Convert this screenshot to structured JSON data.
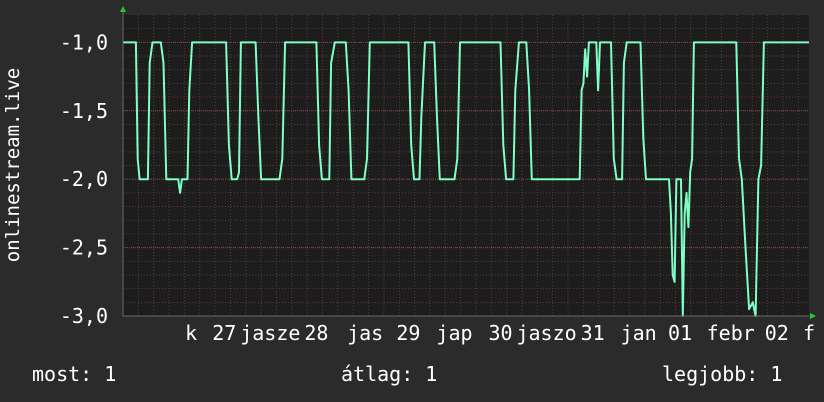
{
  "chart_data": {
    "type": "line",
    "ylabel": "onlinestream.live",
    "ylim": [
      -3.0,
      -0.8
    ],
    "yticks": [
      -3.0,
      -2.5,
      -2.0,
      -1.5,
      -1.0
    ],
    "ytick_labels": [
      "-3,0",
      "-2,5",
      "-2,0",
      "-1,5",
      "-1,0"
    ],
    "x_labels": [
      {
        "x": 0.74,
        "label": "k"
      },
      {
        "x": 1.1,
        "label": "27"
      },
      {
        "x": 1.6,
        "label": "jasze"
      },
      {
        "x": 2.1,
        "label": "28"
      },
      {
        "x": 2.63,
        "label": "jas"
      },
      {
        "x": 3.1,
        "label": "29"
      },
      {
        "x": 3.6,
        "label": "jap"
      },
      {
        "x": 4.1,
        "label": "30"
      },
      {
        "x": 4.6,
        "label": "jaszo"
      },
      {
        "x": 5.1,
        "label": "31"
      },
      {
        "x": 5.6,
        "label": "jan"
      },
      {
        "x": 6.05,
        "label": "01"
      },
      {
        "x": 6.6,
        "label": "febr"
      },
      {
        "x": 7.1,
        "label": "02"
      },
      {
        "x": 7.45,
        "label": "f"
      }
    ],
    "xlim": [
      0,
      7.45
    ],
    "grid": true,
    "series": [
      {
        "color": "#7fffc4",
        "points": [
          [
            0.0,
            -1.0
          ],
          [
            0.14,
            -1.0
          ],
          [
            0.16,
            -1.85
          ],
          [
            0.18,
            -2.0
          ],
          [
            0.27,
            -2.0
          ],
          [
            0.29,
            -1.15
          ],
          [
            0.32,
            -1.0
          ],
          [
            0.41,
            -1.0
          ],
          [
            0.44,
            -1.15
          ],
          [
            0.47,
            -2.0
          ],
          [
            0.6,
            -2.0
          ],
          [
            0.62,
            -2.1
          ],
          [
            0.64,
            -2.0
          ],
          [
            0.7,
            -2.0
          ],
          [
            0.72,
            -1.35
          ],
          [
            0.75,
            -1.0
          ],
          [
            1.12,
            -1.0
          ],
          [
            1.15,
            -1.75
          ],
          [
            1.18,
            -2.0
          ],
          [
            1.24,
            -2.0
          ],
          [
            1.26,
            -1.95
          ],
          [
            1.28,
            -1.0
          ],
          [
            1.44,
            -1.0
          ],
          [
            1.47,
            -1.55
          ],
          [
            1.5,
            -2.0
          ],
          [
            1.7,
            -2.0
          ],
          [
            1.73,
            -1.85
          ],
          [
            1.76,
            -1.0
          ],
          [
            2.1,
            -1.0
          ],
          [
            2.13,
            -1.75
          ],
          [
            2.16,
            -2.0
          ],
          [
            2.24,
            -2.0
          ],
          [
            2.26,
            -1.15
          ],
          [
            2.3,
            -1.0
          ],
          [
            2.42,
            -1.0
          ],
          [
            2.45,
            -1.35
          ],
          [
            2.48,
            -2.0
          ],
          [
            2.62,
            -2.0
          ],
          [
            2.65,
            -1.85
          ],
          [
            2.68,
            -1.0
          ],
          [
            3.1,
            -1.0
          ],
          [
            3.13,
            -1.75
          ],
          [
            3.16,
            -2.0
          ],
          [
            3.22,
            -2.0
          ],
          [
            3.24,
            -1.55
          ],
          [
            3.28,
            -1.0
          ],
          [
            3.38,
            -1.0
          ],
          [
            3.41,
            -1.55
          ],
          [
            3.44,
            -2.0
          ],
          [
            3.6,
            -2.0
          ],
          [
            3.63,
            -1.85
          ],
          [
            3.66,
            -1.0
          ],
          [
            4.1,
            -1.0
          ],
          [
            4.13,
            -1.75
          ],
          [
            4.16,
            -2.0
          ],
          [
            4.24,
            -2.0
          ],
          [
            4.26,
            -1.35
          ],
          [
            4.3,
            -1.0
          ],
          [
            4.38,
            -1.0
          ],
          [
            4.41,
            -1.35
          ],
          [
            4.44,
            -2.0
          ],
          [
            4.96,
            -2.0
          ],
          [
            4.98,
            -1.35
          ],
          [
            5.0,
            -1.3
          ],
          [
            5.02,
            -1.05
          ],
          [
            5.04,
            -1.25
          ],
          [
            5.06,
            -1.0
          ],
          [
            5.14,
            -1.0
          ],
          [
            5.16,
            -1.35
          ],
          [
            5.18,
            -1.0
          ],
          [
            5.3,
            -1.0
          ],
          [
            5.33,
            -1.85
          ],
          [
            5.36,
            -2.0
          ],
          [
            5.42,
            -2.0
          ],
          [
            5.44,
            -1.15
          ],
          [
            5.47,
            -1.0
          ],
          [
            5.62,
            -1.0
          ],
          [
            5.65,
            -1.7
          ],
          [
            5.68,
            -2.0
          ],
          [
            5.9,
            -2.0
          ],
          [
            5.93,
            -2.0
          ],
          [
            5.95,
            -2.25
          ],
          [
            5.97,
            -2.7
          ],
          [
            5.99,
            -2.75
          ],
          [
            6.01,
            -2.0
          ],
          [
            6.06,
            -2.0
          ],
          [
            6.08,
            -3.0
          ],
          [
            6.1,
            -2.25
          ],
          [
            6.12,
            -2.1
          ],
          [
            6.14,
            -2.35
          ],
          [
            6.16,
            -1.95
          ],
          [
            6.18,
            -1.85
          ],
          [
            6.2,
            -1.0
          ],
          [
            6.66,
            -1.0
          ],
          [
            6.69,
            -1.85
          ],
          [
            6.72,
            -2.0
          ],
          [
            6.76,
            -2.5
          ],
          [
            6.8,
            -2.95
          ],
          [
            6.84,
            -2.9
          ],
          [
            6.87,
            -3.0
          ],
          [
            6.9,
            -2.0
          ],
          [
            6.93,
            -1.9
          ],
          [
            6.96,
            -1.0
          ],
          [
            7.45,
            -1.0
          ]
        ]
      }
    ]
  },
  "legend": {
    "current": "most: 1",
    "average": "átlag: 1",
    "best": "legjobb: 1"
  }
}
